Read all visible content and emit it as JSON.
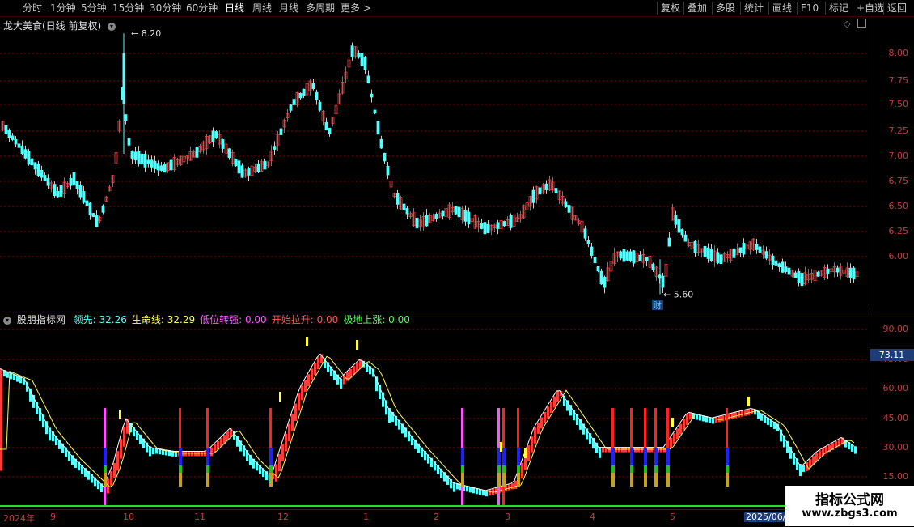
{
  "toolbar": {
    "left_items": [
      "分时",
      "1分钟",
      "5分钟",
      "15分钟",
      "30分钟",
      "60分钟",
      "日线",
      "周线",
      "月线",
      "多周期",
      "更多 >"
    ],
    "active": "日线",
    "right_items": [
      "复权",
      "叠加",
      "多股",
      "统计",
      "画线",
      "F10",
      "标记",
      "+自选",
      "返回"
    ]
  },
  "price_panel": {
    "title": "龙大美食(日线 前复权)",
    "high_label": "8.20",
    "low_label": "5.60",
    "event_badge": "财",
    "axis_ticks": [
      "8.00",
      "7.75",
      "7.50",
      "7.25",
      "7.00",
      "6.75",
      "6.50",
      "6.25",
      "6.00"
    ]
  },
  "indicator_panel": {
    "title": "股朋指标网",
    "lines": [
      {
        "label": "领先:",
        "value": "32.26",
        "color": "#55ffff"
      },
      {
        "label": "生命线:",
        "value": "32.29",
        "color": "#ffff55"
      },
      {
        "label": "低位转强:",
        "value": "0.00",
        "color": "#ff55ff"
      },
      {
        "label": "开始拉升:",
        "value": "0.00",
        "color": "#ff5555"
      },
      {
        "label": "极地上涨:",
        "value": "0.00",
        "color": "#55ff55"
      }
    ],
    "axis_ticks": [
      "90.00",
      "75.00",
      "60.00",
      "45.00",
      "30.00",
      "15.00"
    ],
    "highlight_value": "73.11"
  },
  "date_axis": {
    "labels": [
      "2024年",
      "9",
      "10",
      "11",
      "12",
      "1",
      "2",
      "3",
      "4",
      "5",
      "2025/06/0"
    ]
  },
  "watermark": {
    "line1": "指标公式网",
    "line2": "www.zbgs3.com"
  },
  "colors": {
    "up": "#ff3c3c",
    "down": "#55ffff",
    "grid": "#8b0000",
    "text": "#c8c8c8"
  }
}
